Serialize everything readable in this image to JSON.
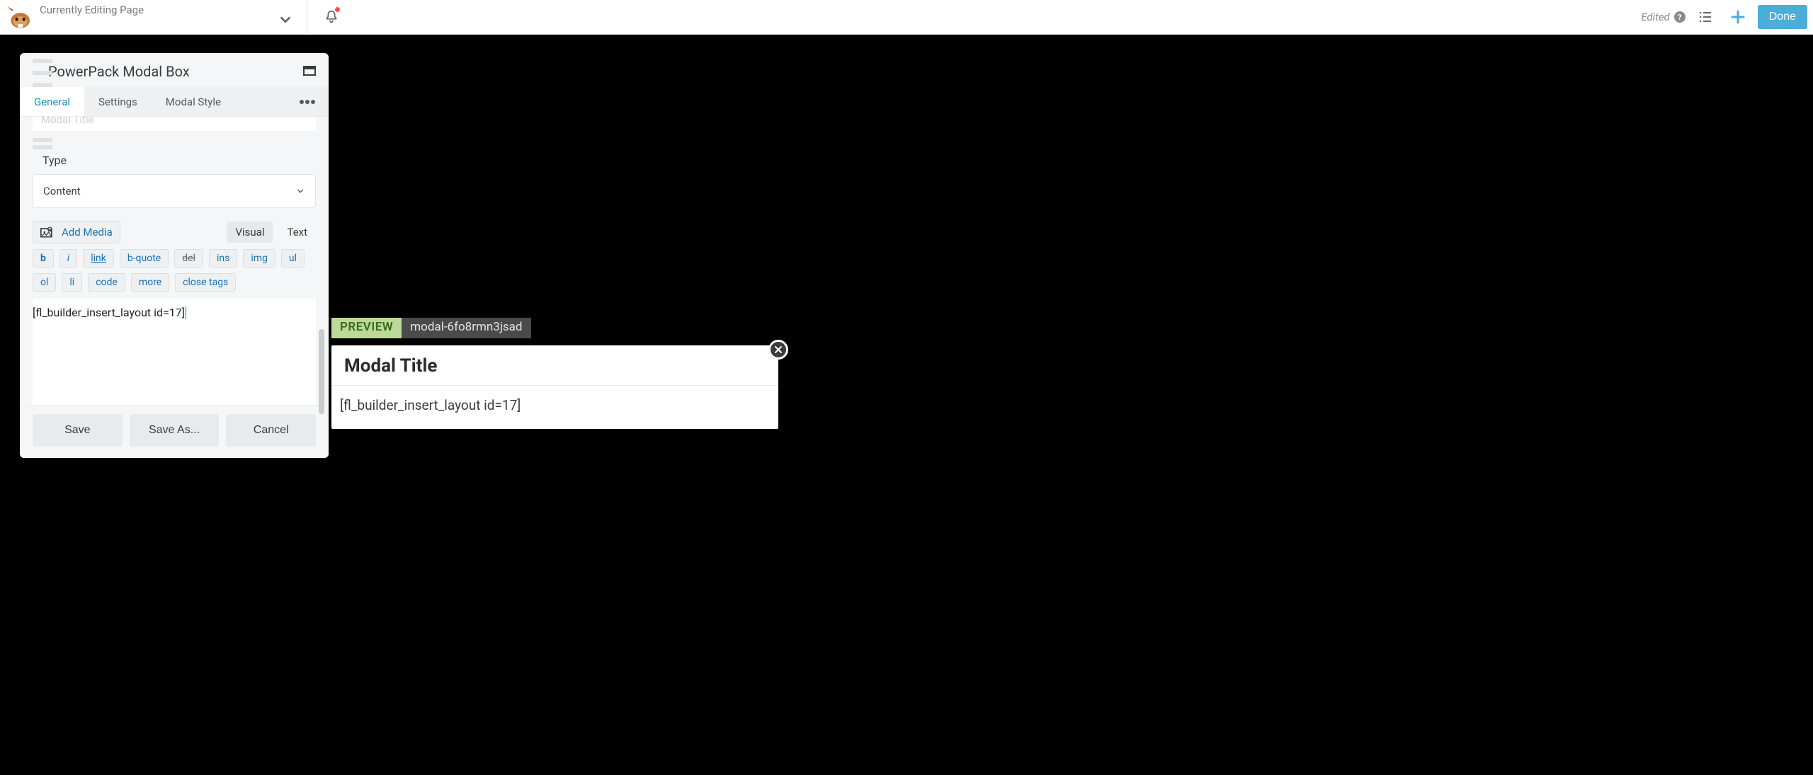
{
  "topbar": {
    "page_title": "Currently Editing Page",
    "edited_label": "Edited",
    "done_label": "Done"
  },
  "panel": {
    "title": "PowerPack Modal Box",
    "tabs": {
      "general": "General",
      "settings": "Settings",
      "modal_style": "Modal Style"
    },
    "cutoff_field_placeholder": "Modal Title",
    "type_label": "Type",
    "type_value": "Content",
    "add_media_label": "Add Media",
    "modes": {
      "visual": "Visual",
      "text": "Text"
    },
    "quicktags": {
      "b": "b",
      "i": "i",
      "link": "link",
      "bquote": "b-quote",
      "del": "del",
      "ins": "ins",
      "img": "img",
      "ul": "ul",
      "ol": "ol",
      "li": "li",
      "code": "code",
      "more": "more",
      "close_tags": "close tags"
    },
    "editor_content": "[fl_builder_insert_layout id=17]",
    "footer": {
      "save": "Save",
      "save_as": "Save As...",
      "cancel": "Cancel"
    }
  },
  "preview": {
    "badge": "PREVIEW",
    "id": "modal-6fo8rmn3jsad",
    "modal_title": "Modal Title",
    "modal_body": "[fl_builder_insert_layout id=17]"
  }
}
